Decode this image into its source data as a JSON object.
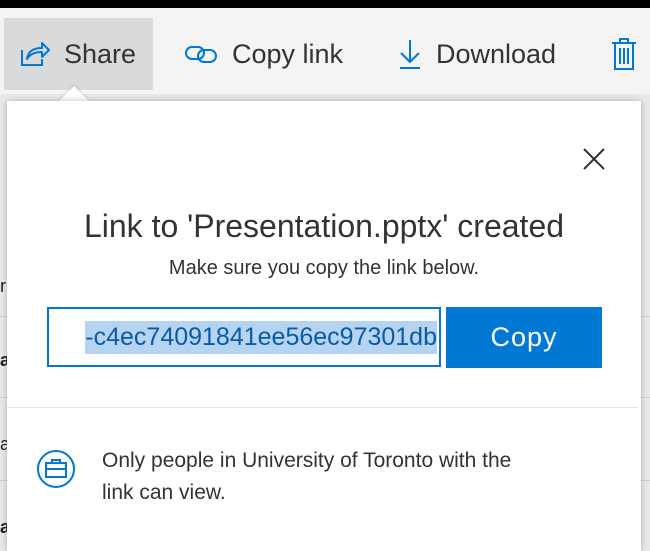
{
  "toolbar": {
    "share_label": "Share",
    "copy_link_label": "Copy link",
    "download_label": "Download"
  },
  "background": {
    "edge_chars": [
      "r",
      "a",
      "a",
      "a"
    ]
  },
  "dialog": {
    "title": "Link to 'Presentation.pptx' created",
    "subtitle": "Make sure you copy the link below.",
    "link_value": "-c4ec74091841ee56ec97301db",
    "copy_label": "Copy",
    "permission_text": "Only people in University of Toronto with the link can view."
  },
  "colors": {
    "accent": "#0078d4",
    "selection": "#b5d4f2"
  }
}
